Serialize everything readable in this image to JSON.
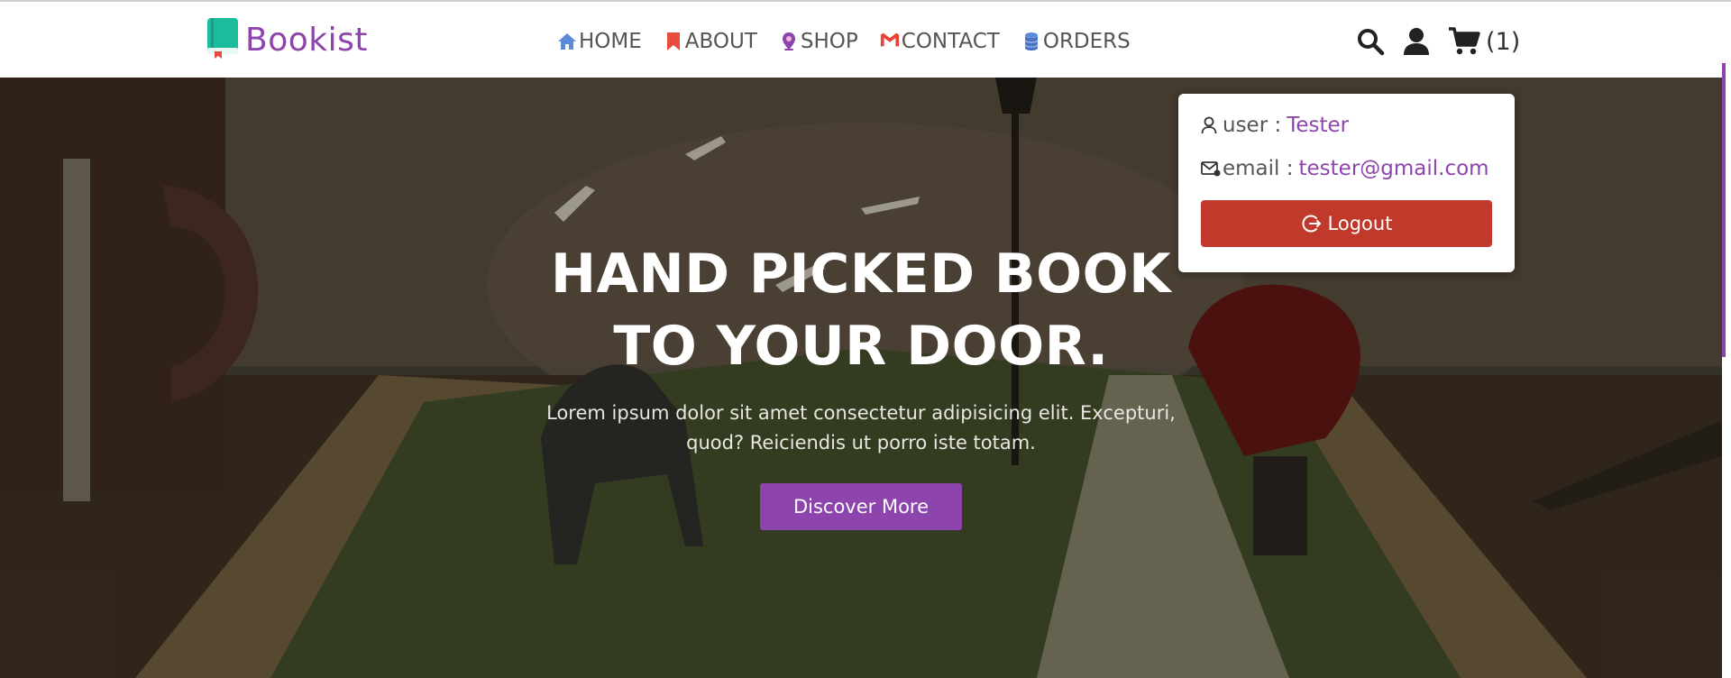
{
  "brand": {
    "name": "Bookist",
    "color": "#8e44ad",
    "logo_icon": "book-icon"
  },
  "nav": [
    {
      "label": "HOME",
      "icon": "home-icon"
    },
    {
      "label": "ABOUT",
      "icon": "bookmark-icon"
    },
    {
      "label": "SHOP",
      "icon": "location-pin-icon"
    },
    {
      "label": "CONTACT",
      "icon": "gmail-icon"
    },
    {
      "label": "ORDERS",
      "icon": "database-icon"
    }
  ],
  "header_icons": {
    "search": "search-icon",
    "account": "user-icon",
    "cart": "cart-icon",
    "cart_count": "(1)"
  },
  "user_box": {
    "user_label": "user :",
    "user_value": "Tester",
    "email_label": "email :",
    "email_value": "tester@gmail.com",
    "logout_label": "Logout",
    "logout_color": "#c0392b"
  },
  "hero": {
    "title_line1": "HAND PICKED BOOK",
    "title_line2": "TO YOUR DOOR.",
    "text_line1": "Lorem ipsum dolor sit amet consectetur adipisicing elit. Excepturi,",
    "text_line2": "quod? Reiciendis ut porro iste totam.",
    "button_label": "Discover More"
  }
}
